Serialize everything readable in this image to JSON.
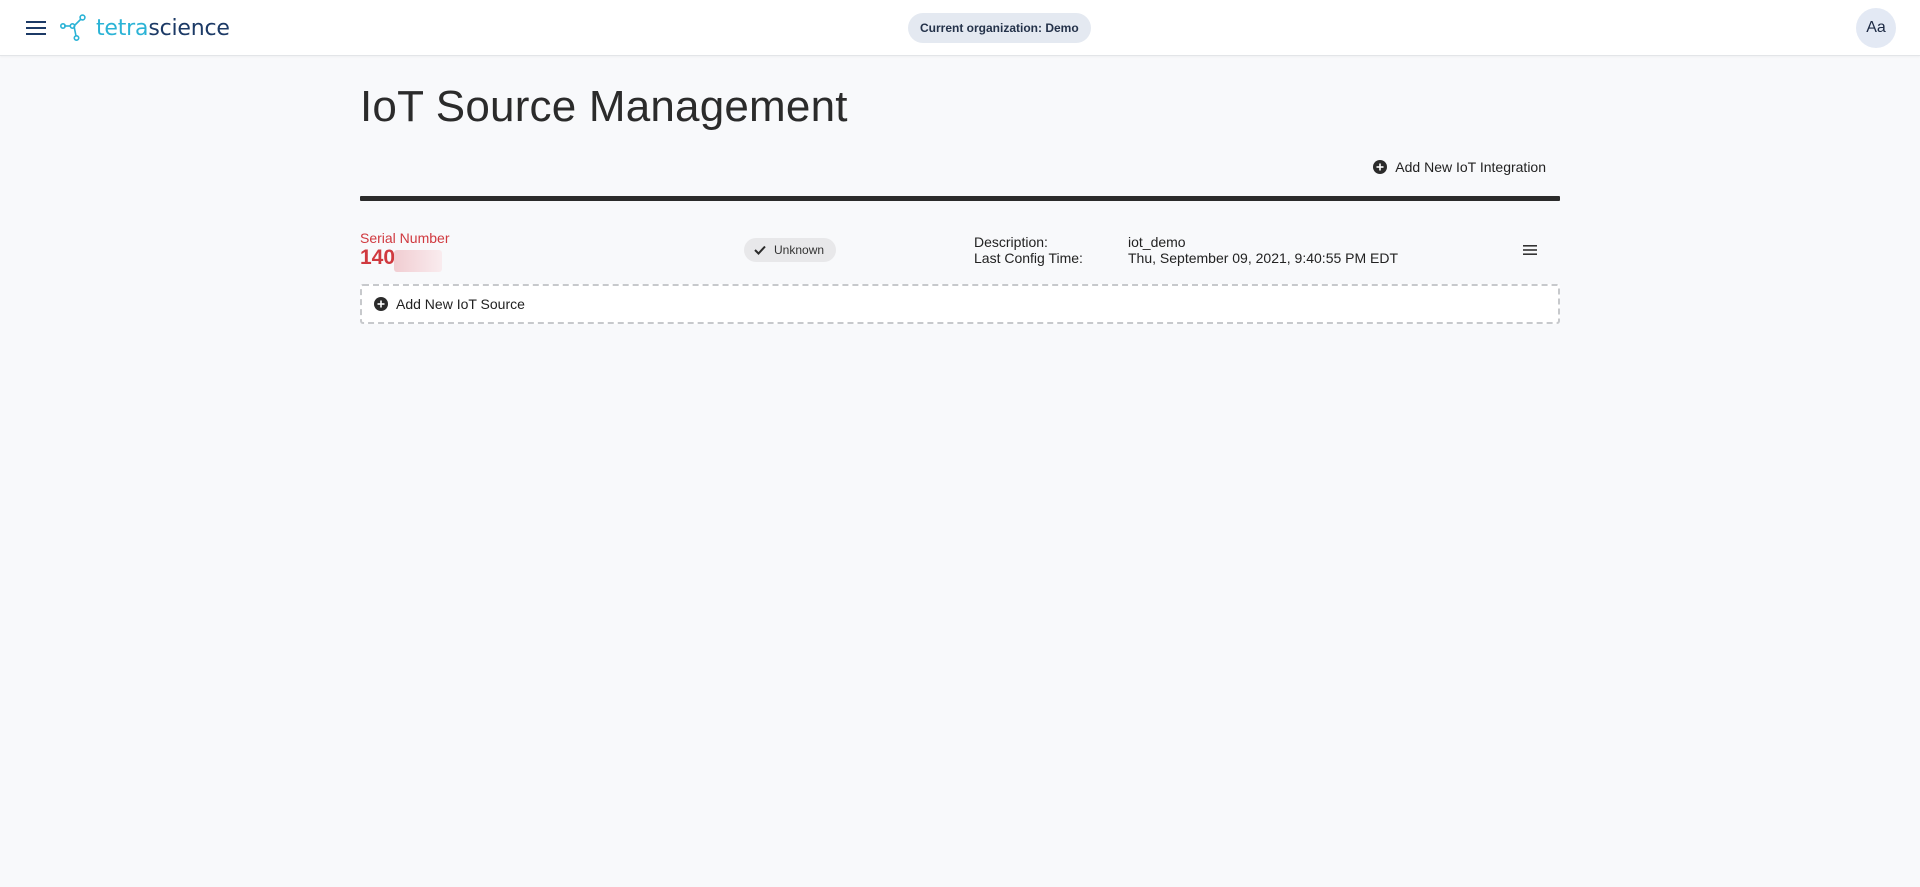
{
  "header": {
    "logo": {
      "tetra": "tetra",
      "science": "science"
    },
    "org_label": "Current organization: Demo",
    "avatar_initials": "Aa"
  },
  "page": {
    "title": "IoT Source Management",
    "add_integration_label": "Add New IoT Integration",
    "add_source_label": "Add New IoT Source"
  },
  "sources": [
    {
      "serial_label": "Serial Number",
      "serial_value": "140",
      "status": "Unknown",
      "description_key": "Description:",
      "description_value": "iot_demo",
      "last_config_key": "Last Config Time:",
      "last_config_value": "Thu, September 09, 2021, 9:40:55 PM EDT"
    }
  ],
  "colors": {
    "accent_red": "#d0393f",
    "logo_cyan": "#2bb3d6",
    "logo_navy": "#1c3a66"
  },
  "icons": {
    "menu": "hamburger-menu-icon",
    "add": "add-circle-icon",
    "status": "checkmark-icon",
    "row_menu": "row-menu-icon"
  }
}
